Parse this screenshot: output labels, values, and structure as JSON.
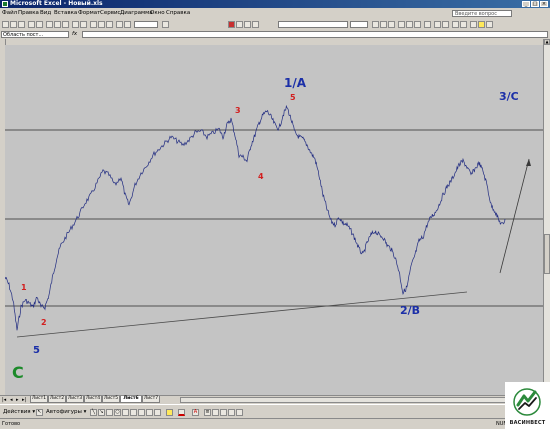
{
  "window": {
    "title": "Microsoft Excel - Новый.xls"
  },
  "menu": {
    "items": [
      "Файл",
      "Правка",
      "Вид",
      "Вставка",
      "Формат",
      "Сервис",
      "Диаграмма",
      "Окно",
      "Справка"
    ],
    "help_placeholder": "Введите вопрос"
  },
  "formula_bar": {
    "name_box": "Область пост...",
    "fx": "fx",
    "value": ""
  },
  "sheet_tabs": {
    "tabs": [
      "Лист1",
      "Лист2",
      "Лист3",
      "Лист4",
      "Лист5",
      "Лист6",
      "Лист7"
    ],
    "active": "Лист6"
  },
  "draw_toolbar": {
    "actions_label": "Действия ▾",
    "autoshapes_label": "Автофигуры ▾"
  },
  "status": {
    "left": "Готово",
    "right": "NUM"
  },
  "chart": {
    "wave_labels": {
      "w1": "1",
      "w2": "2",
      "w3": "3",
      "w4": "4",
      "w5": "5",
      "w5b": "5",
      "C": "C",
      "A": "1/A",
      "B": "2/B",
      "C3": "3/C"
    },
    "colors": {
      "line": "#1f2a80",
      "red_label": "#d21f1f",
      "blue_label": "#1b2fa8",
      "green_label": "#1c8a2a"
    }
  },
  "logo": {
    "text": "ВАСИНВЕСТ"
  }
}
